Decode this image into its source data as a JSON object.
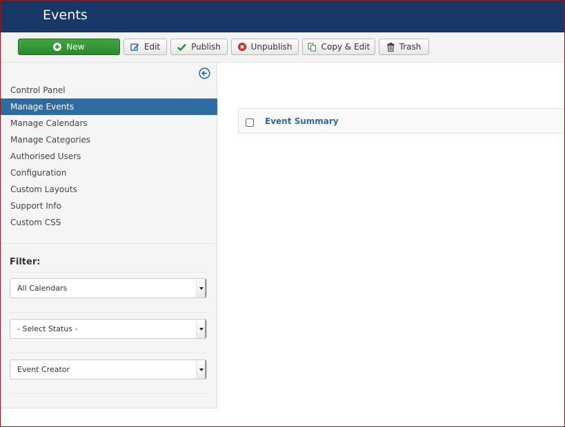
{
  "header": {
    "title": "Events"
  },
  "toolbar": {
    "buttons": [
      {
        "label": "New"
      },
      {
        "label": "Edit"
      },
      {
        "label": "Publish"
      },
      {
        "label": "Unpublish"
      },
      {
        "label": "Copy & Edit"
      },
      {
        "label": "Trash"
      }
    ]
  },
  "sidebar": {
    "items": [
      {
        "label": "Control Panel"
      },
      {
        "label": "Manage Events"
      },
      {
        "label": "Manage Calendars"
      },
      {
        "label": "Manage Categories"
      },
      {
        "label": "Authorised Users"
      },
      {
        "label": "Configuration"
      },
      {
        "label": "Custom Layouts"
      },
      {
        "label": "Support Info"
      },
      {
        "label": "Custom CSS"
      }
    ],
    "active_item": "Manage Events"
  },
  "filter": {
    "label": "Filter:",
    "calendar": "All Calendars",
    "status": "- Select Status -",
    "creator": "Event Creator"
  },
  "table": {
    "column": "Event Summary"
  },
  "icons": {
    "new": "plus-circle-icon",
    "edit": "edit-icon",
    "publish": "check-icon",
    "unpublish": "x-circle-icon",
    "copy": "copy-icon",
    "trash": "trash-icon",
    "collapse": "arrow-left-circle-icon"
  },
  "colors": {
    "header_bg": "#1a3867",
    "active_nav": "#2d6ca2",
    "new_button": "#2f8f2f",
    "link_blue": "#2d6ca2"
  }
}
